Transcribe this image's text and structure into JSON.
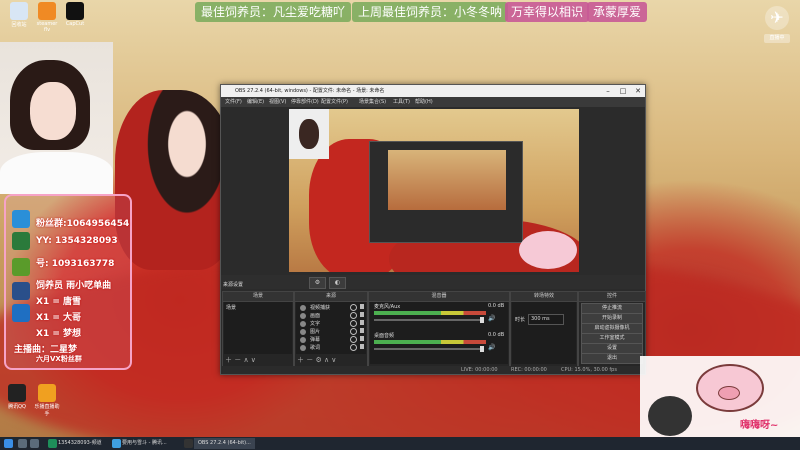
{
  "banner": {
    "item1": "最佳饲养员：凡尘爱吃糖吖",
    "item2": "上周最佳饲养员：小冬冬呐",
    "item3": "万幸得以相识",
    "item4": "承蒙厚爱"
  },
  "desktop_icons": [
    {
      "label": "回收站"
    },
    {
      "label": "steamer flv"
    },
    {
      "label": "CapCut"
    },
    {
      "label": "腾讯QQ"
    },
    {
      "label": "乐播直播助手"
    }
  ],
  "rank_panel": {
    "rows": [
      {
        "label": "粉丝群:1064956454"
      },
      {
        "label": "YY:  1354328093"
      },
      {
        "label": "号:  1093163778"
      },
      {
        "label": "饲养员  雨小呓单曲"
      },
      {
        "label": "X1  =  唐雪"
      },
      {
        "label": "X1  =  大哥"
      },
      {
        "label": "X1  =  梦想"
      },
      {
        "label": "主播曲：二星梦"
      },
      {
        "label": "六月VX粉丝群"
      }
    ]
  },
  "obs": {
    "title": "OBS 27.2.4 (64-bit, windows) - 配置文件: 未命名 - 场景: 未命名",
    "menu": [
      "文件(F)",
      "编辑(E)",
      "视图(V)",
      "停靠部件(D)",
      "配置文件(P)",
      "场景集合(S)",
      "工具(T)",
      "帮助(H)"
    ],
    "toolbar_label": "来源设置",
    "docks": {
      "scenes": "场景",
      "sources": "来源",
      "mixer": "混音器",
      "transitions": "转场特效",
      "controls": "控件"
    },
    "scene_item": "场景",
    "sources": [
      "视频捕获",
      "画面",
      "文字",
      "图片",
      "弹幕",
      "歌词"
    ],
    "mixer": [
      {
        "label": "麦克风/Aux",
        "db": "0.0 dB"
      },
      {
        "label": "桌面音频",
        "db": "0.0 dB"
      }
    ],
    "transition": {
      "duration_label": "时长",
      "duration_value": "300 ms"
    },
    "controls": [
      "停止推流",
      "开始录制",
      "启动虚拟摄像机",
      "工作室模式",
      "设置",
      "退出"
    ],
    "status": {
      "live": "LIVE: 00:00:00",
      "rec": "REC: 00:00:00",
      "cpu": "CPU: 15.0%, 30.00 fps"
    }
  },
  "right": {
    "badge": "直播中"
  },
  "pig_text": "嗨嗨呀~",
  "taskbar": {
    "items": [
      "1354328093-频道",
      "要用与雪斗 - 腾讯...",
      "OBS 27.2.4 (64-bit)..."
    ]
  }
}
